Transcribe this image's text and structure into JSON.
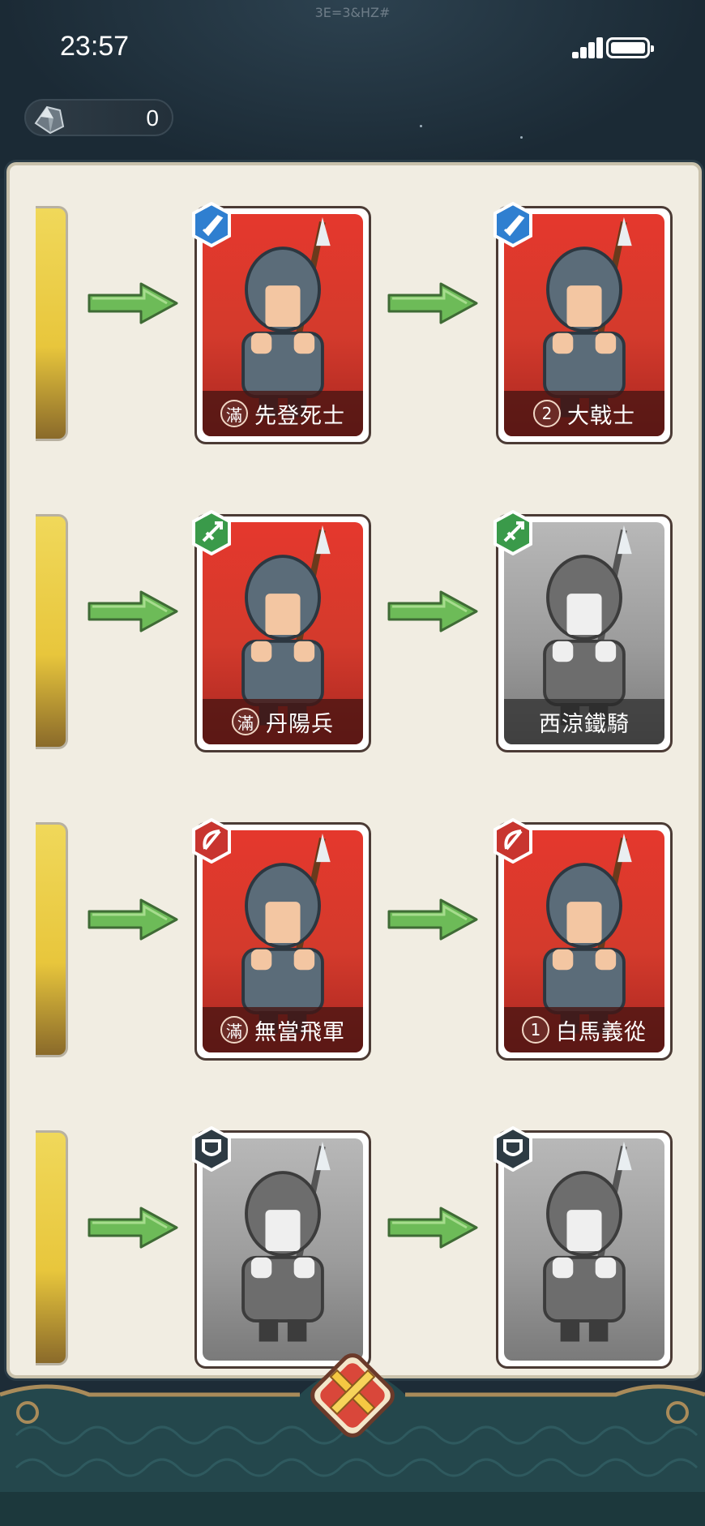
{
  "status_bar": {
    "time": "23:57",
    "watermark": "3E=3&HZ#"
  },
  "resource": {
    "icon": "ore-icon",
    "value": "0"
  },
  "rows": [
    {
      "mid": {
        "name": "先登死士",
        "level": "滿",
        "badge": "sword-badge",
        "color": "red"
      },
      "right": {
        "name": "大戟士",
        "level": "2",
        "badge": "sword-badge",
        "color": "red"
      }
    },
    {
      "mid": {
        "name": "丹陽兵",
        "level": "滿",
        "badge": "spear-badge",
        "color": "red"
      },
      "right": {
        "name": "西涼鐵騎",
        "level": "",
        "badge": "spear-badge",
        "color": "gray"
      }
    },
    {
      "mid": {
        "name": "無當飛軍",
        "level": "滿",
        "badge": "bow-badge",
        "color": "red"
      },
      "right": {
        "name": "白馬義從",
        "level": "1",
        "badge": "bow-badge",
        "color": "red"
      }
    },
    {
      "mid": {
        "name": "",
        "level": "",
        "badge": "shield-badge",
        "color": "gray"
      },
      "right": {
        "name": "",
        "level": "",
        "badge": "shield-badge",
        "color": "gray"
      }
    }
  ],
  "close_button": {
    "icon": "crossed-swords-close-icon"
  },
  "colors": {
    "arrow": "#6dbb58",
    "card_red": "#d93a2c",
    "panel": "#f1ede2"
  }
}
